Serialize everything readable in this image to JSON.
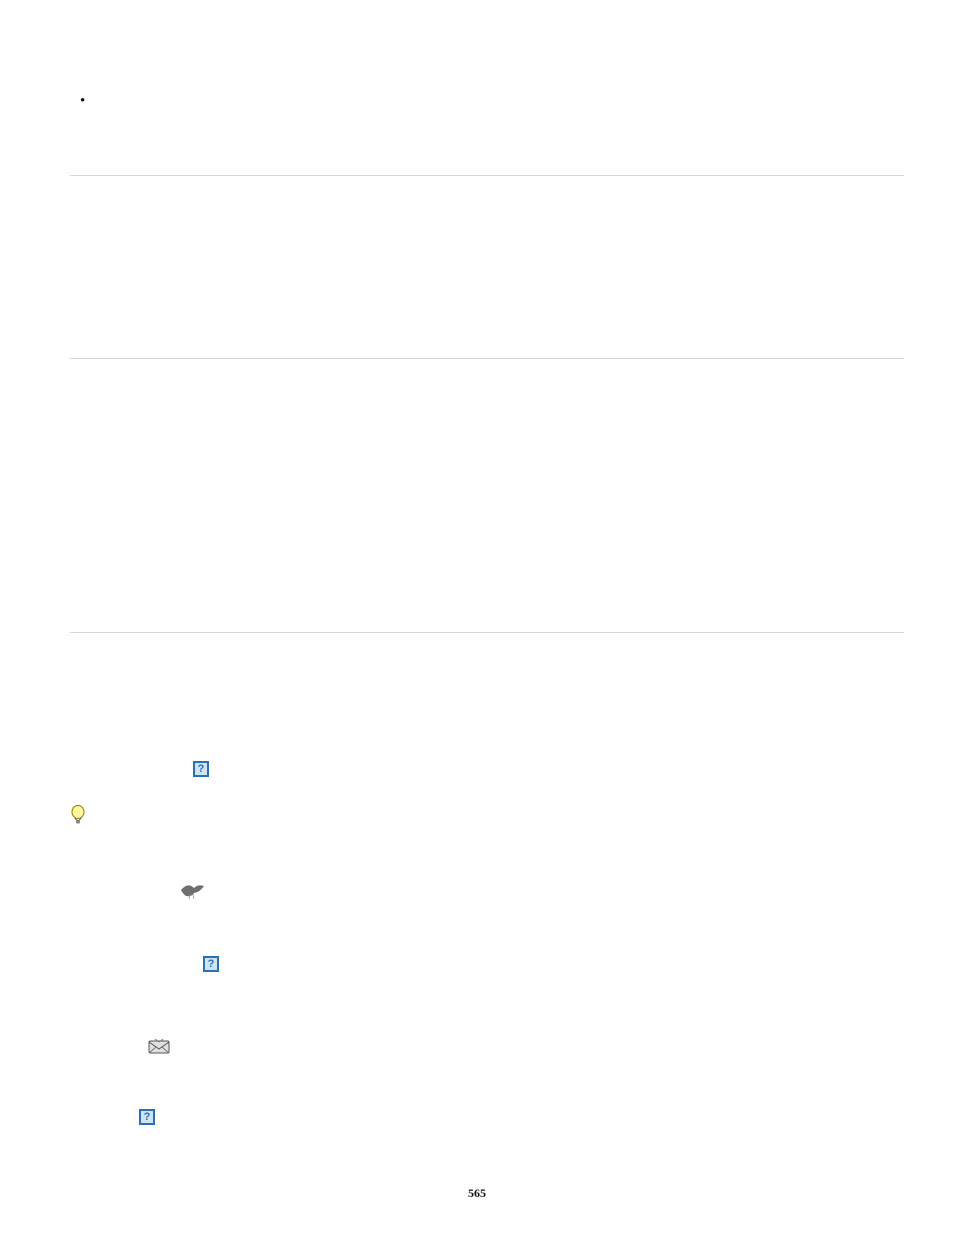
{
  "bullet": "•",
  "icons": {
    "q1_label": "?",
    "q2_label": "?",
    "q3_label": "?"
  },
  "pagenum": "565"
}
